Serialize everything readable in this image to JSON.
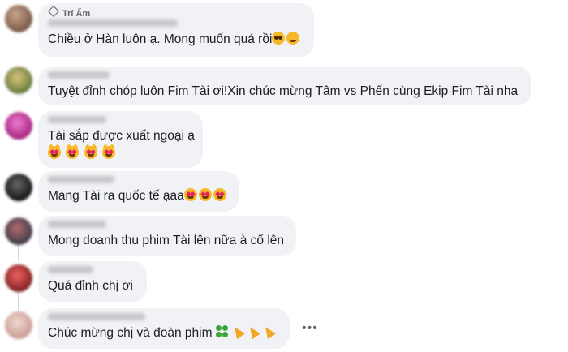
{
  "comments": [
    {
      "badge": "Trí Ấm",
      "author": "Nguyễn Hoài Phương Uyên",
      "text": "Chiều ở Hàn luôn ạ. Mong muốn quá rồi",
      "emojis": [
        "pleading-face",
        "smiling-face-with-tear"
      ]
    },
    {
      "author": "Chinh Angel",
      "text": "Tuyệt đỉnh chóp luôn Fim Tài ơi!Xin chúc mừng Tâm vs Phến cùng Ekip Fim Tài nha"
    },
    {
      "author": "Hồng Nhung",
      "text": "Tài sắp được xuất ngoại ạ",
      "emojis": [
        "heart-eyes-cat",
        "heart-eyes-cat",
        "heart-eyes-cat",
        "heart-eyes-cat"
      ]
    },
    {
      "author": "Nguyễn Linh",
      "text": "Mang Tài ra quốc tế ạaa",
      "emojis": [
        "heart-eyes",
        "heart-eyes",
        "heart-eyes"
      ]
    },
    {
      "author": "Tuyết Ngân",
      "text": "Mong doanh thu phim Tài lên nữa à cố lên"
    },
    {
      "author": "Trần Nga",
      "text": "Quá đỉnh chị ơi"
    },
    {
      "author": "Thái Huỳnh Phương",
      "text": "Chúc mừng chị và đoàn phim",
      "emojis": [
        "four-leaf-clover",
        "party-popper",
        "party-popper",
        "party-popper"
      ],
      "more_label": "•••"
    }
  ],
  "colors": {
    "bubble": "#f0f2f5",
    "text": "#1c1e21",
    "meta": "#65676b"
  }
}
